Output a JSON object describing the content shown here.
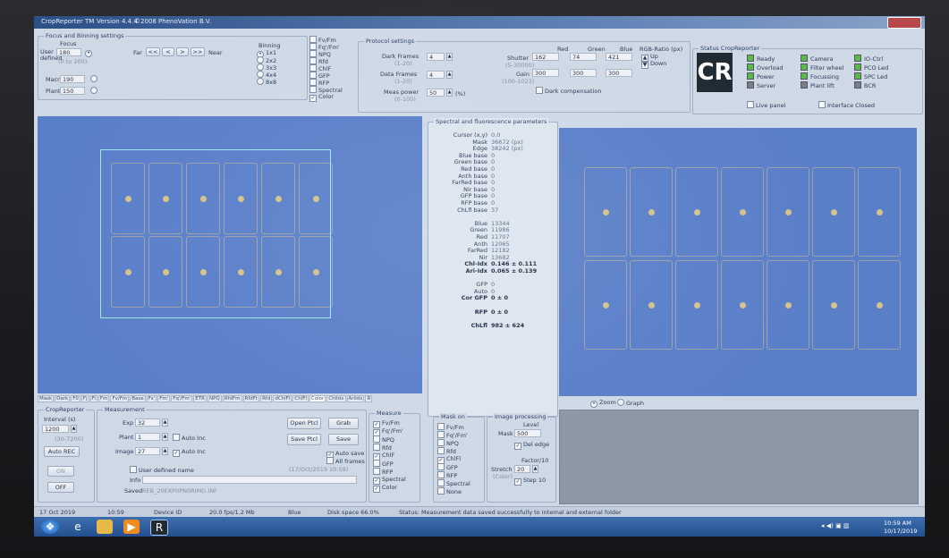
{
  "app": {
    "title": "CropReporter TM",
    "version": "Version 4.4.4",
    "copyright": "©2008 PhenoVation B.V."
  },
  "focus": {
    "group_title": "Focus and Binning settings",
    "focus_label": "Focus",
    "user_defined_label": "User defined",
    "user_value": "180",
    "user_range": "(0 to 200)",
    "far_label": "Far",
    "near_label": "Near",
    "nav_buttons": [
      "<<",
      "<",
      ">",
      ">>"
    ],
    "macro_label": "Macro",
    "macro_value": "190",
    "plant_label": "Plant",
    "plant_value": "150",
    "binning_label": "Binning",
    "binning_options": [
      "1x1",
      "2x2",
      "3x3",
      "4x4",
      "8x8"
    ]
  },
  "measure_types": [
    "Fv/Fm",
    "Fq'/Fm'",
    "NPQ",
    "Rfd",
    "ChlF",
    "GFP",
    "RFP",
    "Spectral",
    "Color"
  ],
  "protocol": {
    "group_title": "Protocol settings",
    "dark_frames_label": "Dark Frames",
    "dark_frames_range": "(1-20)",
    "dark_frames_value": "4",
    "data_frames_label": "Data Frames",
    "data_frames_range": "(1-20)",
    "data_frames_value": "4",
    "meas_power_label": "Meas power",
    "meas_power_range": "(0-100)",
    "meas_power_value": "50",
    "meas_power_unit": "(%)",
    "col_red": "Red",
    "col_green": "Green",
    "col_blue": "Blue",
    "shutter_label": "Shutter",
    "shutter_range": "(5-30000)",
    "shutter_red": "162",
    "shutter_green": "74",
    "shutter_blue": "421",
    "gain_label": "Gain",
    "gain_range": "(100-1023)",
    "gain_red": "300",
    "gain_green": "300",
    "gain_blue": "300",
    "rgb_ratio_label": "RGB-Ratio (px)",
    "up_label": "Up",
    "down_label": "Down",
    "dark_comp_label": "Dark compensation"
  },
  "status": {
    "group_title": "Status CropReporter",
    "logo_text": "CR",
    "col1": [
      "Ready",
      "Overload",
      "Power",
      "Server"
    ],
    "col2": [
      "Camera",
      "Filter wheel",
      "Focussing",
      "Plant lift"
    ],
    "col3": [
      "IO-Ctrl",
      "PCO Led",
      "SPC Led",
      "BCR"
    ],
    "live_panel_label": "Live panel",
    "interface_label": "Interface Closed"
  },
  "tabs": [
    "Mask",
    "Dark",
    "F0",
    "Fj",
    "Fi",
    "Fm",
    "Fv/Fm",
    "Base",
    "Fs'",
    "Fm'",
    "Fq'/Fm'",
    "ETR",
    "NPQ",
    "RfdFm",
    "RfdFt",
    "Rfd",
    "dChlFl",
    "ChlFl",
    "Color",
    "ChlIdx",
    "AriIdx",
    "R"
  ],
  "spectral": {
    "title": "Spectral and fluorescence parameters",
    "rows": [
      {
        "label": "Cursor (x,y)",
        "value": "0,0"
      },
      {
        "label": "Mask",
        "value": "36672 (px)"
      },
      {
        "label": "Edge",
        "value": "38242 (px)"
      },
      {
        "label": "Blue base",
        "value": "0"
      },
      {
        "label": "Green base",
        "value": "0"
      },
      {
        "label": "Red base",
        "value": "0"
      },
      {
        "label": "Anth base",
        "value": "0"
      },
      {
        "label": "FarRed base",
        "value": "0"
      },
      {
        "label": "Nir base",
        "value": "0"
      },
      {
        "label": "GFP base",
        "value": "0"
      },
      {
        "label": "RFP base",
        "value": "0"
      },
      {
        "label": "ChLfl base",
        "value": "37"
      },
      {
        "label": "",
        "value": ""
      },
      {
        "label": "Blue",
        "value": "13344"
      },
      {
        "label": "Green",
        "value": "11986"
      },
      {
        "label": "Red",
        "value": "11707"
      },
      {
        "label": "Anth",
        "value": "12065"
      },
      {
        "label": "FarRed",
        "value": "12182"
      },
      {
        "label": "Nir",
        "value": "13682"
      },
      {
        "label": "Chl-Idx",
        "value": "0.146 ± 0.111"
      },
      {
        "label": "Ari-Idx",
        "value": "0.065 ± 0.139"
      },
      {
        "label": "",
        "value": ""
      },
      {
        "label": "GFP",
        "value": "0"
      },
      {
        "label": "Auto",
        "value": "0"
      },
      {
        "label": "Cor GFP",
        "value": "0 ± 0"
      },
      {
        "label": "",
        "value": ""
      },
      {
        "label": "RFP",
        "value": "0 ± 0"
      },
      {
        "label": "",
        "value": ""
      },
      {
        "label": "ChLfl",
        "value": "982 ± 624"
      }
    ]
  },
  "view_mode": {
    "zoom": "Zoom",
    "graph": "Graph"
  },
  "cropreporter": {
    "group_title": "CropReporter",
    "interval_label": "Interval (s)",
    "interval_value": "1200",
    "interval_range": "(30-7200)",
    "auto_rec_label": "Auto REC",
    "on_label": "ON",
    "off_label": "OFF"
  },
  "measurement": {
    "group_title": "Measurement",
    "exp_label": "Exp",
    "exp_value": "32",
    "plant_label": "Plant",
    "plant_value": "1",
    "image_label": "Image",
    "image_value": "27",
    "auto_inc_label": "Auto Inc",
    "user_name_label": "User defined name",
    "info_label": "Info",
    "saved_label": "Saved",
    "saved_value": "REB_20EXP0PN0RIMG.INF",
    "open_ptcl": "Open Ptcl",
    "save_ptcl": "Save Ptcl",
    "grab": "Grab",
    "save": "Save",
    "auto_save": "Auto save",
    "all_frames": "All frames",
    "timestamp": "(17/Oct/2019 10:59)"
  },
  "measure_group": {
    "title": "Measure"
  },
  "mask_on": {
    "title": "Mask on",
    "items": [
      "Fv/Fm",
      "Fq'/Fm'",
      "NPQ",
      "Rfd",
      "ChlFl",
      "GFP",
      "RFP",
      "Spectral",
      "None"
    ]
  },
  "image_processing": {
    "title": "Image processing",
    "level_label": "Level",
    "mask_label": "Mask",
    "mask_value": "500",
    "del_edge_label": "Del edge",
    "factor_label": "Factor/10",
    "stretch_label": "Stretch",
    "stretch_value": "20",
    "color_label": "(Color)",
    "step_label": "Step 10"
  },
  "statusbar": {
    "date": "17 Oct 2019",
    "time": "10:59",
    "device": "Device ID",
    "fps": "20.0 fps/1.2 Mb",
    "color": "Blue",
    "disk": "Disk space 66.0%",
    "status": "Status: Measurement data saved successfully to internal and external folder"
  },
  "taskbar": {
    "time": "10:59 AM",
    "date": "10/17/2019"
  },
  "colors": {
    "accent": "#2c4f86",
    "image_bg": "#5a7fc9",
    "led_on": "#5db84a",
    "led_off": "#7a7f86"
  }
}
